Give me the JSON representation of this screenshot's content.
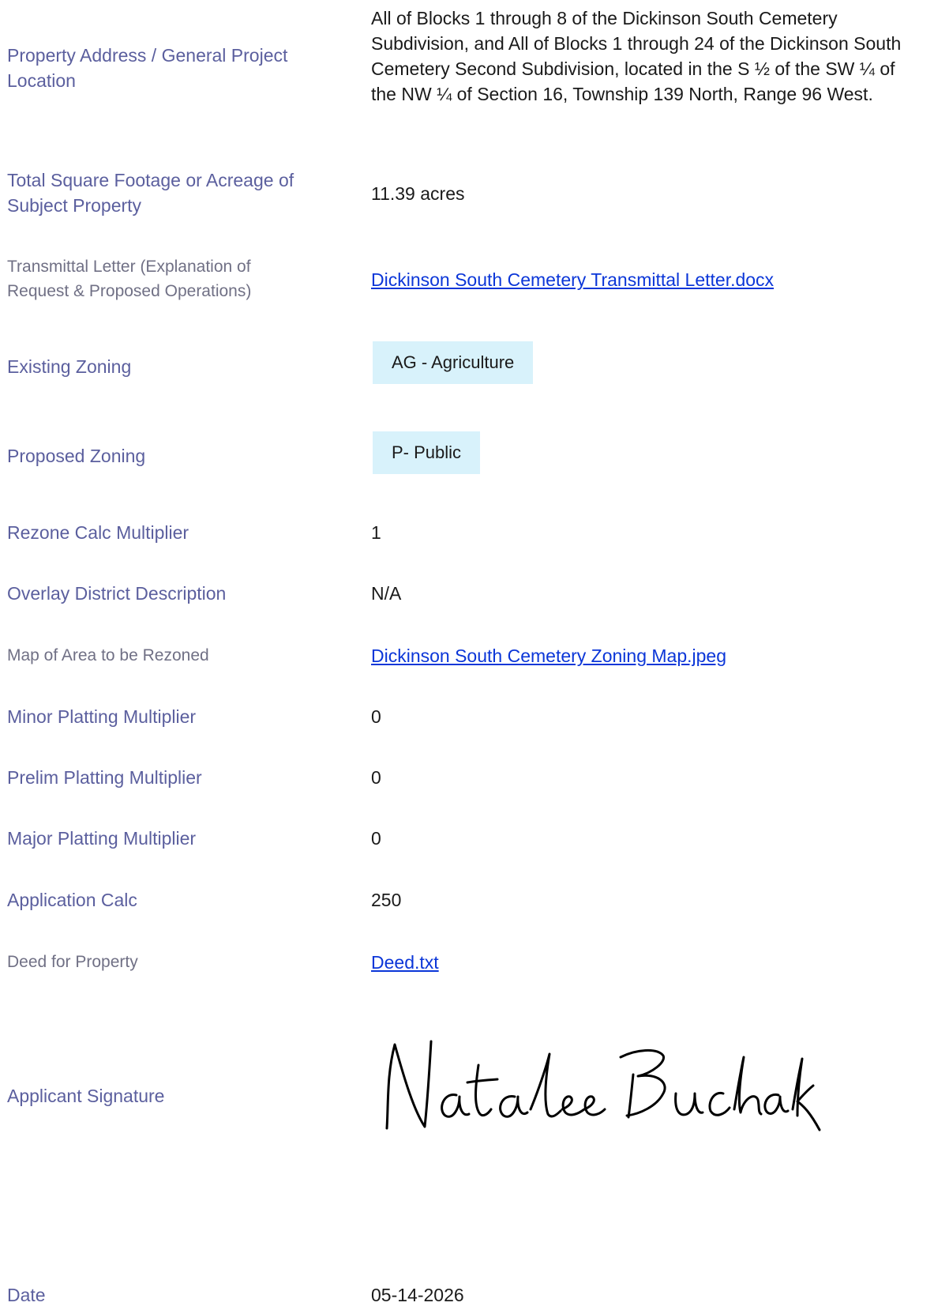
{
  "rows": {
    "address": {
      "label": "Property Address / General Project Location",
      "value": "All of Blocks 1 through 8 of the Dickinson South Cemetery Subdivision, and All of Blocks 1 through 24 of the Dickinson South Cemetery Second Subdivision, located in the S ½ of the SW ¼ of the NW ¼ of Section 16, Township 139 North, Range 96 West."
    },
    "acreage": {
      "label": "Total Square Footage or Acreage of Subject Property",
      "value": "11.39 acres"
    },
    "transmittal": {
      "label": "Transmittal Letter (Explanation of Request & Proposed Operations)",
      "value": "Dickinson South Cemetery Transmittal Letter.docx"
    },
    "existing_zoning": {
      "label": "Existing Zoning",
      "value": "AG - Agriculture"
    },
    "proposed_zoning": {
      "label": "Proposed Zoning",
      "value": "P- Public"
    },
    "rezone_multiplier": {
      "label": "Rezone Calc Multiplier",
      "value": "1"
    },
    "overlay": {
      "label": "Overlay District Description",
      "value": "N/A"
    },
    "map": {
      "label": "Map of Area to be Rezoned",
      "value": "Dickinson South Cemetery Zoning Map.jpeg"
    },
    "minor_platting": {
      "label": "Minor Platting Multiplier",
      "value": "0"
    },
    "prelim_platting": {
      "label": "Prelim Platting Multiplier",
      "value": "0"
    },
    "major_platting": {
      "label": "Major Platting Multiplier",
      "value": "0"
    },
    "application_calc": {
      "label": "Application Calc",
      "value": "250"
    },
    "deed": {
      "label": "Deed for Property",
      "value": "Deed.txt"
    },
    "signature": {
      "label": "Applicant Signature",
      "signed_name": "Natalee Buchak"
    },
    "date": {
      "label": "Date",
      "value": "05-14-2026"
    }
  },
  "colors": {
    "label": "#5b5f9e",
    "link": "#0b36d8",
    "pill_background": "#d8f2fb"
  }
}
